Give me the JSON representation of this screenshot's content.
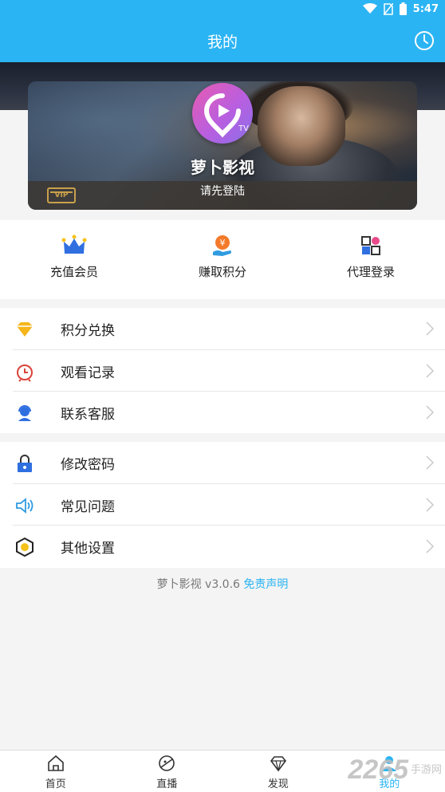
{
  "status_bar": {
    "time": "5:47"
  },
  "header": {
    "title": "我的"
  },
  "profile": {
    "name": "萝卜影视",
    "login_hint": "请先登陆",
    "vip_badge": "VIP"
  },
  "quick_actions": [
    {
      "label": "充值会员",
      "icon": "crown-icon"
    },
    {
      "label": "赚取积分",
      "icon": "coin-hand-icon"
    },
    {
      "label": "代理登录",
      "icon": "agent-grid-icon"
    }
  ],
  "menu_group_1": [
    {
      "label": "积分兑换",
      "icon": "diamond-icon"
    },
    {
      "label": "观看记录",
      "icon": "alarm-clock-icon"
    },
    {
      "label": "联系客服",
      "icon": "headset-icon"
    }
  ],
  "menu_group_2": [
    {
      "label": "修改密码",
      "icon": "lock-icon"
    },
    {
      "label": "常见问题",
      "icon": "speaker-icon"
    },
    {
      "label": "其他设置",
      "icon": "hexagon-settings-icon"
    }
  ],
  "footer": {
    "version_text": "萝卜影视 v3.0.6 ",
    "disclaimer": "免责声明"
  },
  "tabs": [
    {
      "label": "首页",
      "icon": "home-icon",
      "active": false
    },
    {
      "label": "直播",
      "icon": "planet-icon",
      "active": false
    },
    {
      "label": "发现",
      "icon": "diamond-outline-icon",
      "active": false
    },
    {
      "label": "我的",
      "icon": "user-icon",
      "active": true
    }
  ],
  "watermark": {
    "number": "2265",
    "text_line1": "手游网",
    "text_line2": ""
  },
  "colors": {
    "primary": "#2bb4f3",
    "background": "#f4f4f4"
  }
}
